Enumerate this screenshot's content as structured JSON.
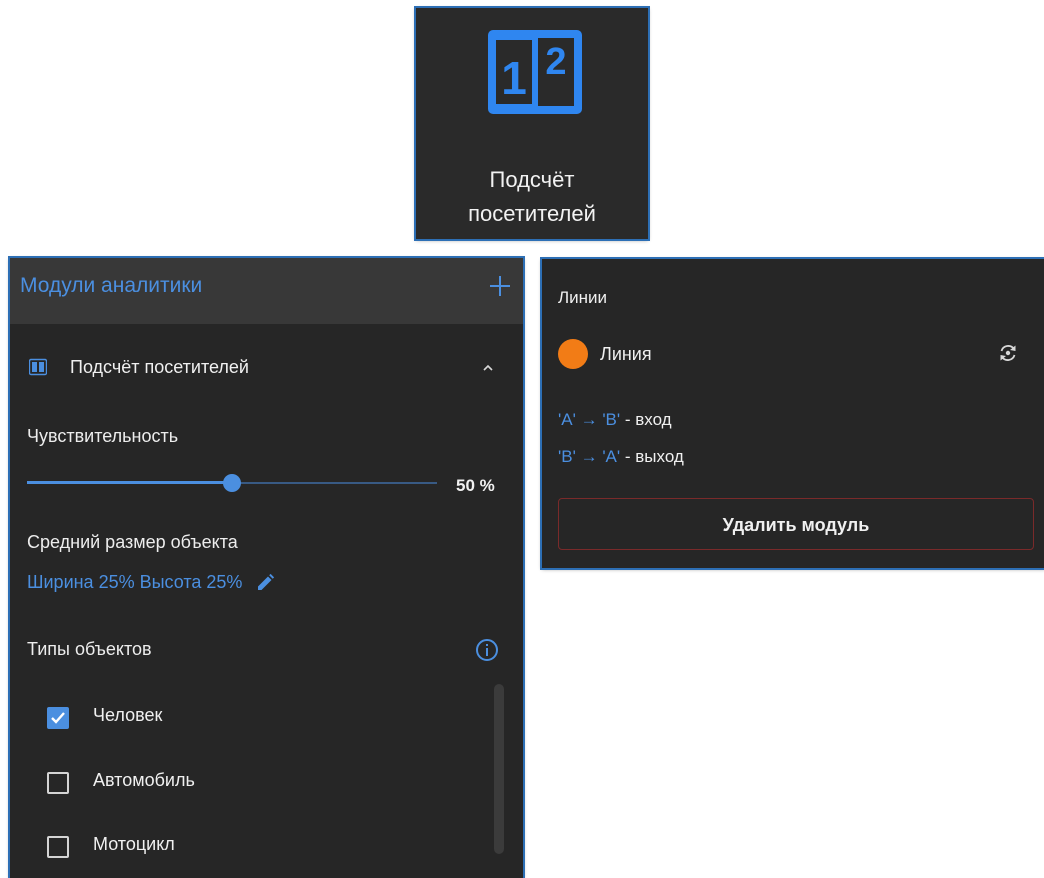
{
  "tile": {
    "label": "Подсчёт посетителей",
    "icon": "people-counter-icon",
    "icon_digits": [
      "1",
      "2"
    ]
  },
  "panel": {
    "title": "Модули аналитики",
    "add_icon": "plus-icon",
    "module": {
      "label": "Подсчёт посетителей",
      "icon": "people-counter-icon",
      "expand_icon": "chevron-up-icon"
    },
    "sensitivity": {
      "label": "Чувствительность",
      "value": 50,
      "value_text": "50 %"
    },
    "object_size": {
      "label": "Средний размер объекта",
      "value_text": "Ширина 25% Высота 25%",
      "edit_icon": "pencil-icon"
    },
    "object_types": {
      "label": "Типы объектов",
      "info_icon": "info-icon",
      "items": [
        {
          "label": "Человек",
          "checked": true
        },
        {
          "label": "Автомобиль",
          "checked": false
        },
        {
          "label": "Мотоцикл",
          "checked": false
        }
      ]
    }
  },
  "lines": {
    "title": "Линии",
    "line_name": "Линия",
    "line_color": "#f27c16",
    "swap_icon": "swap-direction-icon",
    "directions": [
      {
        "from": "'A'",
        "arrow": "→",
        "to": "'B'",
        "meaning": " - вход"
      },
      {
        "from": "'B'",
        "arrow": "→",
        "to": "'A'",
        "meaning": " - выход"
      }
    ],
    "delete_label": "Удалить модуль"
  },
  "colors": {
    "accent": "#4b8fe0",
    "panel_bg": "#262626",
    "header_bg": "#383838",
    "danger_border": "#7a2a2a"
  }
}
